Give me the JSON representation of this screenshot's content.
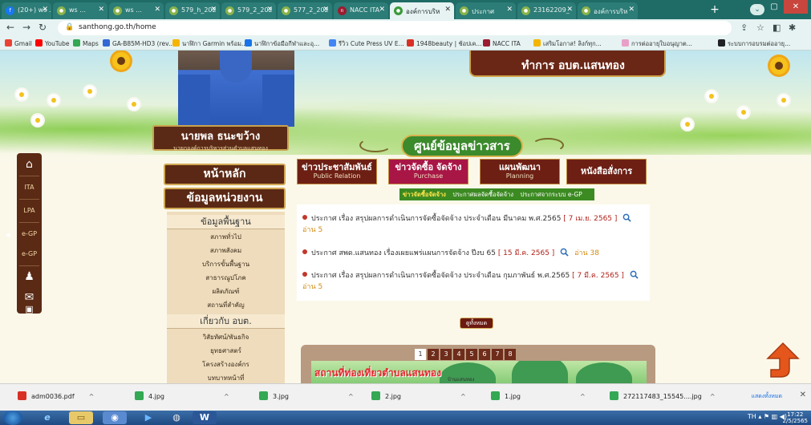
{
  "browser": {
    "tabs": [
      {
        "label": "(20+) ws ..."
      },
      {
        "label": "ws ..."
      },
      {
        "label": "ws ..."
      },
      {
        "label": "579_h_202"
      },
      {
        "label": "579_2_202"
      },
      {
        "label": "577_2_202"
      },
      {
        "label": "NACC ITA"
      },
      {
        "label": "องค์การบริห"
      },
      {
        "label": "ประกาศ"
      },
      {
        "label": "23162209_"
      },
      {
        "label": "องค์การบริห"
      }
    ],
    "url": "santhong.go.th/home",
    "bookmarks": [
      "Gmail",
      "YouTube",
      "Maps",
      "GA-B85M-HD3 (rev...",
      "นาฬิกา Garmin พร้อม...",
      "นาฬิกาข้อมือกีฬาและอุ...",
      "รีวิว Cute Press UV E...",
      "1948beauty | ช้อปเค...",
      "NACC ITA",
      "เสริมโอกาส! ลิงก์ทุก...",
      "การต่ออายุใบอนุญาต...",
      "ระบบการอบรมต่ออายุ..."
    ]
  },
  "header": {
    "top_banner": "ทำการ อบต.แสนทอง",
    "person_name": "นายพล ธนะขว้าง",
    "person_position": "นายกองค์การบริหารส่วนตำบลแสนทอง",
    "section_banner": "ศูนย์ข้อมูลข่าวสาร"
  },
  "sidebar": {
    "items": [
      "ITA",
      "LPA",
      "e-GP",
      "e-GP"
    ]
  },
  "left_menu": {
    "home": "หน้าหลัก",
    "agency_info": "ข้อมูลหน่วยงาน",
    "basic_head": "ข้อมูลพื้นฐาน",
    "basic_items": [
      "สภาพทั่วไป",
      "สภาพสังคม",
      "บริการขั้นพื้นฐาน",
      "สาธารณูปโภค",
      "ผลิตภัณฑ์",
      "สถานที่สำคัญ"
    ],
    "about_head": "เกี่ยวกับ อบต.",
    "about_items": [
      "วิสัยทัศน์/พันธกิจ",
      "ยุทธศาสตร์",
      "โครงสร้างองค์กร",
      "บทบาทหน้าที่"
    ]
  },
  "content_tabs": [
    {
      "th": "ข่าวประชาสัมพันธ์",
      "en": "Public Relation"
    },
    {
      "th": "ข่าวจัดซื้อ จัดจ้าง",
      "en": "Purchase"
    },
    {
      "th": "แผนพัฒนา",
      "en": "Planning"
    },
    {
      "th": "หนังสือสั่งการ",
      "en": ""
    }
  ],
  "sub_tabs": [
    "ข่าวจัดซื้อจัดจ้าง",
    "ประกาศผลจัดซื้อจัดจ้าง",
    "ประกาศจากระบบ e-GP"
  ],
  "news": [
    {
      "title": "ประกาศ เรื่อง สรุปผลการดำเนินการจัดซื้อจัดจ้าง ประจำเดือน มีนาคม พ.ศ.2565",
      "date": "[ 7 เม.ย. 2565 ]",
      "reads": "อ่าน 5"
    },
    {
      "title": "ประกาศ สพด.แสนทอง เรื่องเผยแพร่แผนการจัดจ้าง ปีงบ 65",
      "date": "[ 15 มี.ค. 2565 ]",
      "reads": "อ่าน 38"
    },
    {
      "title": "ประกาศ เรื่อง สรุปผลการดำเนินการจัดซื้อจัดจ้าง ประจำเดือน กุมภาพันธ์ พ.ศ.2565",
      "date": "[ 7 มี.ค. 2565 ]",
      "reads": "อ่าน 5"
    }
  ],
  "all_button": "ดูทั้งหมด",
  "gallery": {
    "pages": [
      "1",
      "2",
      "3",
      "4",
      "5",
      "6",
      "7",
      "8"
    ],
    "title": "สถานที่ท่องเที่ยวตำบลแสนทอง",
    "subtitle": "บ้านแสนทอง"
  },
  "downloads": [
    {
      "name": "adm0036.pdf",
      "color": "#d93025"
    },
    {
      "name": "4.jpg",
      "color": "#34a853"
    },
    {
      "name": "3.jpg",
      "color": "#34a853"
    },
    {
      "name": "2.jpg",
      "color": "#34a853"
    },
    {
      "name": "1.jpg",
      "color": "#34a853"
    },
    {
      "name": "272117483_15545....jpg",
      "color": "#34a853"
    }
  ],
  "show_all": "แสดงทั้งหมด",
  "taskbar": {
    "lang": "TH",
    "time": "17:22",
    "date": "2/5/2565"
  }
}
